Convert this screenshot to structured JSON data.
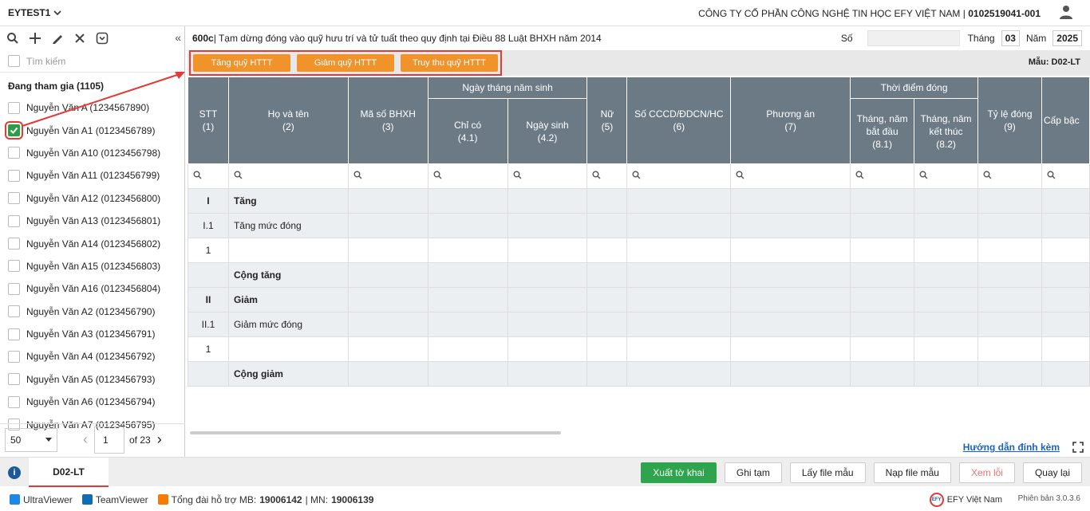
{
  "app": {
    "name": "EYTEST1",
    "company_name": "CÔNG TY CỔ PHẦN CÔNG NGHỆ TIN HỌC EFY VIỆT NAM",
    "company_sep": " | ",
    "tax_code": "0102519041-001"
  },
  "sidebar": {
    "search_placeholder": "Tìm kiếm",
    "group_title": "Đang tham gia (1105)",
    "employees": [
      "Nguyễn Văn A (1234567890)",
      "Nguyễn Văn A1 (0123456789)",
      "Nguyễn Văn A10 (0123456798)",
      "Nguyễn Văn A11 (0123456799)",
      "Nguyễn Văn A12 (0123456800)",
      "Nguyễn Văn A13 (0123456801)",
      "Nguyễn Văn A14 (0123456802)",
      "Nguyễn Văn A15 (0123456803)",
      "Nguyễn Văn A16 (0123456804)",
      "Nguyễn Văn A2 (0123456790)",
      "Nguyễn Văn A3 (0123456791)",
      "Nguyễn Văn A4 (0123456792)",
      "Nguyễn Văn A5 (0123456793)",
      "Nguyễn Văn A6 (0123456794)",
      "Nguyễn Văn A7 (0123456795)"
    ],
    "checked_index": 1,
    "page_size": "50",
    "page": "1",
    "of_label": "of",
    "total_pages": "23"
  },
  "form": {
    "code": "600c",
    "title": " | Tạm dừng đóng vào quỹ hưu trí và tử tuất theo quy định tại Điều 88 Luật BHXH năm 2014",
    "so_label": "Số",
    "so_value": "",
    "month_label": "Tháng",
    "month": "03",
    "year_label": "Năm",
    "year": "2025",
    "template_label": "Mẫu: D02-LT"
  },
  "actions": [
    "Tăng quỹ HTTT",
    "Giảm quỹ HTTT",
    "Truy thu quỹ HTTT"
  ],
  "table": {
    "headers": {
      "stt": "STT",
      "stt_n": "(1)",
      "name": "Họ và tên",
      "name_n": "(2)",
      "bhxh": "Mã số BHXH",
      "bhxh_n": "(3)",
      "dob_group": "Ngày tháng năm sinh",
      "dob_only": "Chỉ có",
      "dob_only_n": "(4.1)",
      "dob": "Ngày sinh",
      "dob_n": "(4.2)",
      "female": "Nữ",
      "female_n": "(5)",
      "id": "Số CCCD/ĐDCN/HC",
      "id_n": "(6)",
      "plan": "Phương án",
      "plan_n": "(7)",
      "time_group": "Thời điểm đóng",
      "start": "Tháng, năm bắt đầu",
      "start_n": "(8.1)",
      "end": "Tháng, năm kết thúc",
      "end_n": "(8.2)",
      "rate": "Tỷ lệ đóng",
      "rate_n": "(9)",
      "level": "Cấp bậc"
    },
    "rows": [
      {
        "stt": "I",
        "name": "Tăng",
        "type": "section"
      },
      {
        "stt": "I.1",
        "name": "Tăng mức đóng",
        "type": "sub"
      },
      {
        "stt": "1",
        "name": "",
        "type": "item"
      },
      {
        "stt": "",
        "name": "Cộng tăng",
        "type": "section"
      },
      {
        "stt": "II",
        "name": "Giảm",
        "type": "section"
      },
      {
        "stt": "II.1",
        "name": "Giảm mức đóng",
        "type": "sub"
      },
      {
        "stt": "1",
        "name": "",
        "type": "item"
      },
      {
        "stt": "",
        "name": "Cộng giảm",
        "type": "section"
      }
    ]
  },
  "guide_link": "Hướng dẫn đính kèm",
  "bottom": {
    "tab": "D02-LT",
    "buttons": {
      "export": "Xuất tờ khai",
      "save": "Ghi tạm",
      "get_template": "Lấy file mẫu",
      "load_template": "Nạp file mẫu",
      "view_errors": "Xem lỗi",
      "back": "Quay lại"
    }
  },
  "footer": {
    "ultraviewer": "UltraViewer",
    "teamviewer": "TeamViewer",
    "hotline_label": "Tổng đài hỗ trợ MB: ",
    "hotline_mb": "19006142",
    "hotline_sep": " | MN: ",
    "hotline_mn": "19006139",
    "efy": "EFY Việt Nam",
    "version": "Phiên bản 3.0.3.6"
  },
  "colors": {
    "header": "#6c7a86",
    "orange": "#f0932b",
    "green": "#2ea44f",
    "highlight": "#e53935",
    "link": "#1565c0"
  }
}
